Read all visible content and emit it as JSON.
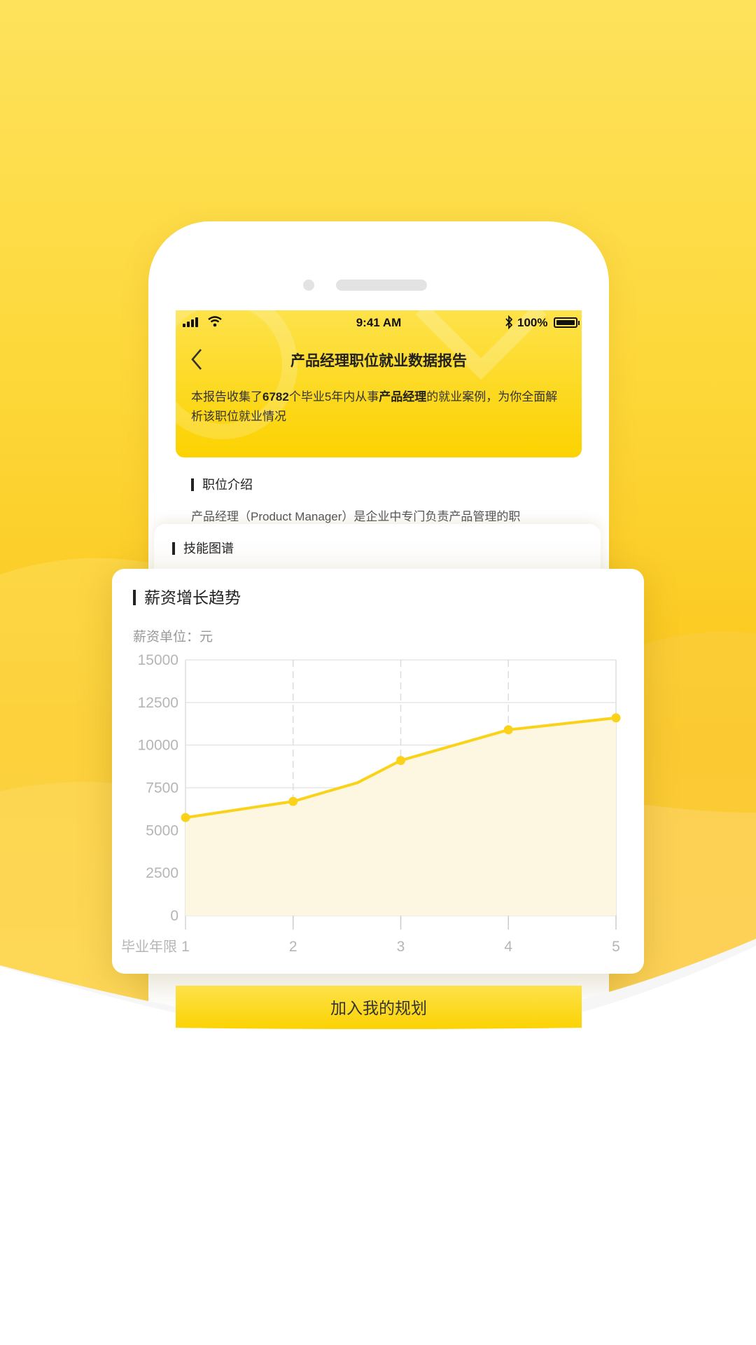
{
  "colors": {
    "brand_yellow": "#fcd200",
    "line_yellow": "#fbd21a",
    "area_fill": "#fdf7e1",
    "text_dark": "#222222",
    "text_gray": "#999999"
  },
  "status_bar": {
    "time": "9:41 AM",
    "battery": "100%",
    "icons": [
      "signal-icon",
      "wifi-icon",
      "bluetooth-icon",
      "battery-icon"
    ]
  },
  "header": {
    "title": "产品经理职位就业数据报告",
    "intro_prefix": "本报告收集了",
    "intro_count": "6782",
    "intro_mid": "个毕业5年内从事",
    "intro_job": "产品经理",
    "intro_suffix": "的就业案例，为你全面解析该职位就业情况"
  },
  "sections": {
    "job_intro_title": "职位介绍",
    "job_intro_text": "产品经理（Product Manager）是企业中专门负责产品管理的职",
    "skills_title": "技能图谱",
    "salary_title": "薪资增长趋势",
    "salary_unit": "薪资单位：元"
  },
  "chart_data": {
    "type": "area",
    "title": "薪资增长趋势",
    "xlabel": "毕业年限",
    "ylabel": "薪资单位：元",
    "x": [
      1,
      2,
      2.6,
      3,
      4,
      5
    ],
    "x_ticks": [
      "1",
      "2",
      "3",
      "4",
      "5"
    ],
    "y_ticks": [
      "15000",
      "12500",
      "10000",
      "7500",
      "5000",
      "2500",
      "0"
    ],
    "ylim": [
      0,
      15000
    ],
    "xlim": [
      1,
      5
    ],
    "series": [
      {
        "values": [
          5750,
          6700,
          7800,
          9100,
          10900,
          11600
        ],
        "markers": [
          true,
          true,
          false,
          true,
          true,
          true
        ]
      }
    ],
    "grid": true
  },
  "actions": {
    "add_plan_label": "加入我的规划"
  }
}
